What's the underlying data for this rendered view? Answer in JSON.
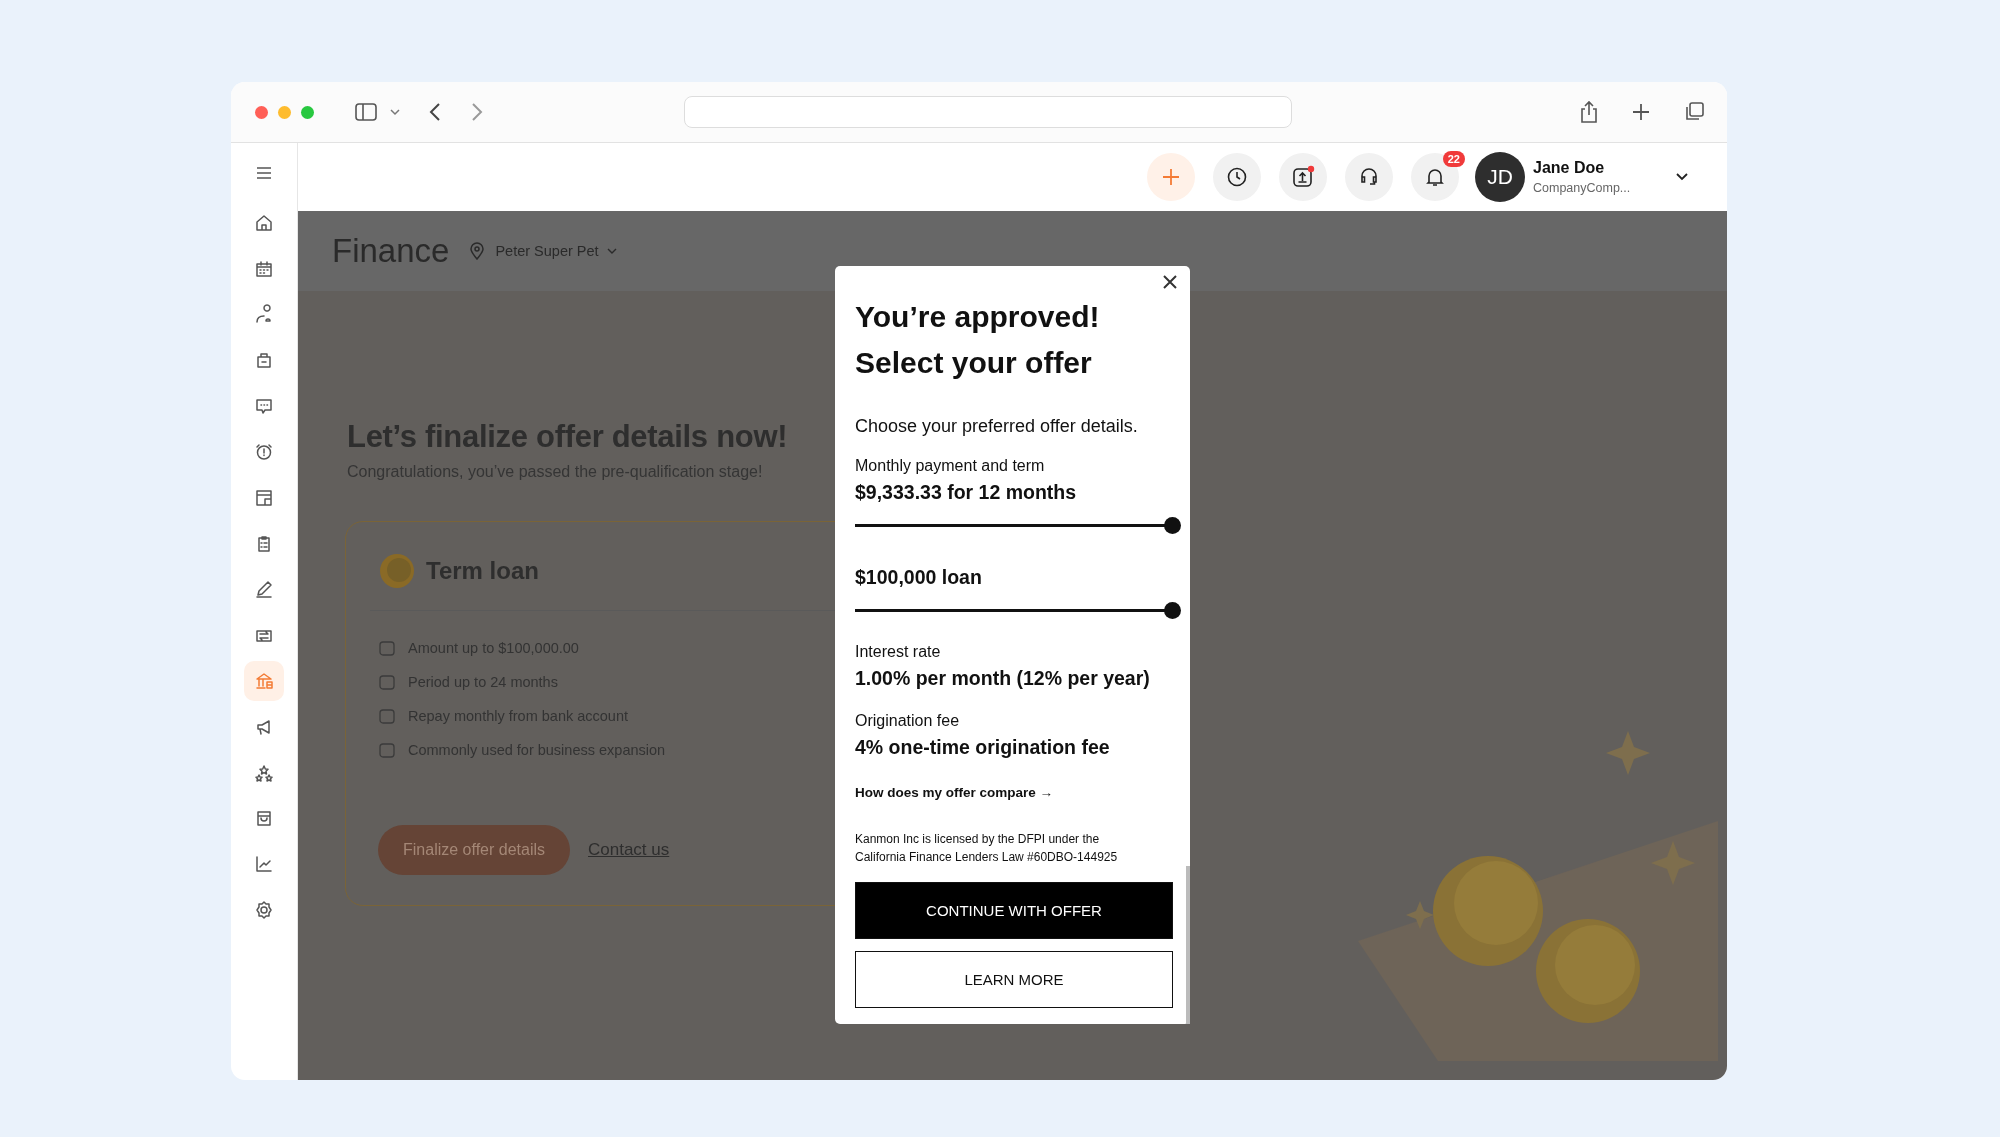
{
  "header": {
    "notifications_badge": "22",
    "user": {
      "initials": "JD",
      "name": "Jane Doe",
      "company": "CompanyComp..."
    }
  },
  "sidebar": {
    "items": [
      {
        "selected": false
      },
      {
        "selected": false
      },
      {
        "selected": false
      },
      {
        "selected": false
      },
      {
        "selected": false
      },
      {
        "selected": false
      },
      {
        "selected": false
      },
      {
        "selected": false
      },
      {
        "selected": false
      },
      {
        "selected": false
      },
      {
        "selected": true
      },
      {
        "selected": false
      },
      {
        "selected": false
      },
      {
        "selected": false
      },
      {
        "selected": false
      },
      {
        "selected": false
      }
    ]
  },
  "page": {
    "title": "Finance",
    "location": "Peter Super Pet",
    "headline": "Let’s finalize offer details now!",
    "subtitle": "Congratulations, you’ve passed the pre-qualification stage!",
    "card": {
      "title": "Term loan",
      "features": [
        "Amount up to $100,000.00",
        "Period up to 24 months",
        "Repay monthly from bank account",
        "Commonly used for business expansion"
      ],
      "primary_button": "Finalize offer details",
      "link": "Contact us"
    }
  },
  "modal": {
    "title_lines": [
      "You’re approved!",
      "Select your offer"
    ],
    "intro": "Choose your preferred offer details.",
    "sliders": [
      {
        "label": "Monthly payment and term",
        "value": "$9,333.33 for 12 months",
        "level": 1
      },
      {
        "value": "$100,000 loan",
        "level": 1
      }
    ],
    "details": [
      {
        "label": "Interest rate",
        "value": "1.00% per month (12% per year)"
      },
      {
        "label": "Origination fee",
        "value": "4% one-time origination fee"
      }
    ],
    "compare_link": "How does my offer compare →",
    "legal": "Kanmon Inc is licensed by the DFPI under the California Finance Lenders Law #60DBO-144925",
    "buttons": [
      {
        "label": "CONTINUE WITH OFFER",
        "kind": "primary"
      },
      {
        "label": "LEARN MORE",
        "kind": "secondary"
      }
    ]
  }
}
